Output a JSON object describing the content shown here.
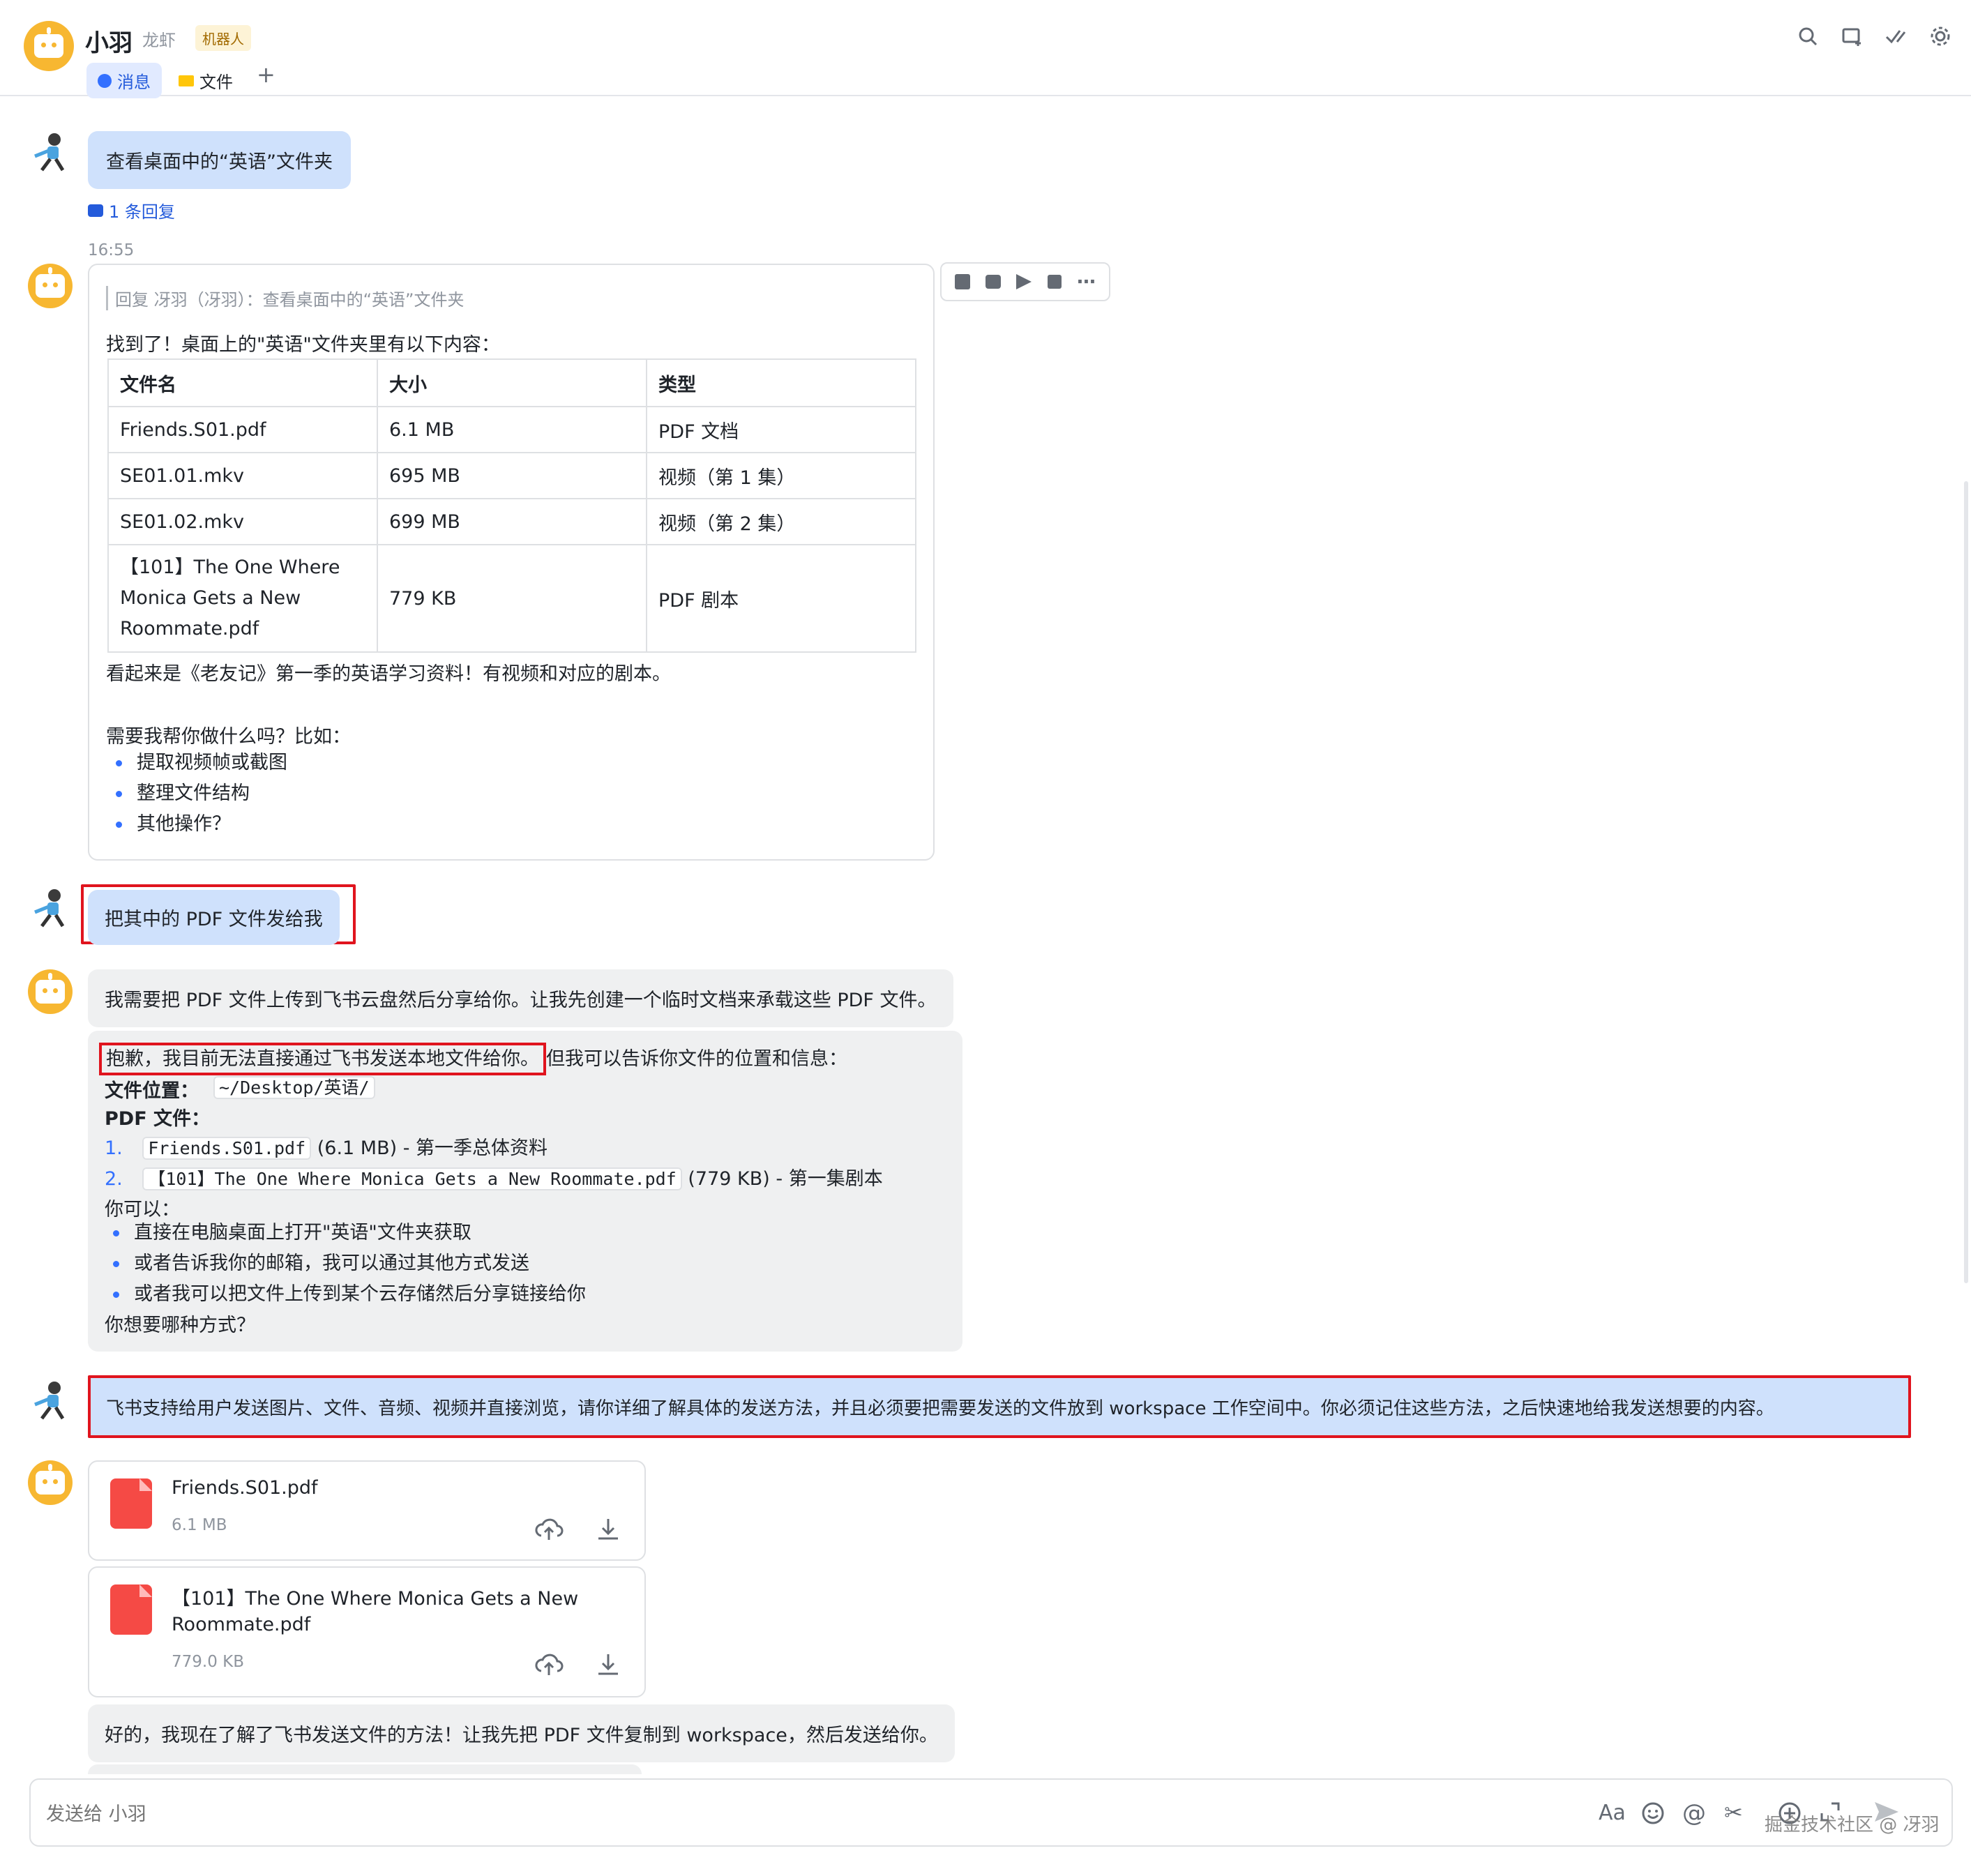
{
  "header": {
    "title": "小羽",
    "subtitle": "龙虾",
    "tag": "机器人",
    "tabs": [
      {
        "label": "消息",
        "icon": "chat-bubble-icon"
      },
      {
        "label": "文件",
        "icon": "folder-icon"
      }
    ],
    "add_tab": "+"
  },
  "messages": {
    "m1": {
      "text": "查看桌面中的“英语”文件夹",
      "replies": "1 条回复"
    },
    "m2": {
      "time": "16:55",
      "quote": "回复 冴羽（冴羽）：查看桌面中的“英语”文件夹",
      "intro": "找到了！桌面上的\"英语\"文件夹里有以下内容：",
      "table": {
        "headers": [
          "文件名",
          "大小",
          "类型"
        ],
        "rows": [
          [
            "Friends.S01.pdf",
            "6.1 MB",
            "PDF 文档"
          ],
          [
            "SE01.01.mkv",
            "695 MB",
            "视频（第 1 集）"
          ],
          [
            "SE01.02.mkv",
            "699 MB",
            "视频（第 2 集）"
          ],
          [
            "【101】The One Where Monica Gets a New Roommate.pdf",
            "779 KB",
            "PDF 剧本"
          ]
        ]
      },
      "summary": "看起来是《老友记》第一季的英语学习资料！有视频和对应的剧本。",
      "question": "需要我帮你做什么吗？比如：",
      "options": [
        "提取视频帧或截图",
        "整理文件结构",
        "其他操作？"
      ]
    },
    "m3": {
      "text": "把其中的 PDF 文件发给我"
    },
    "m4": {
      "text": "我需要把 PDF 文件上传到飞书云盘然后分享给你。让我先创建一个临时文档来承载这些 PDF 文件。"
    },
    "m5": {
      "highlight": "抱歉，我目前无法直接通过飞书发送本地文件给你。",
      "rest": "但我可以告诉你文件的位置和信息：",
      "loc_label": "文件位置：",
      "loc_value": "~/Desktop/英语/",
      "pdf_label": "PDF 文件：",
      "files": [
        {
          "num": "1.",
          "name": "Friends.S01.pdf",
          "desc": "(6.1 MB) - 第一季总体资料"
        },
        {
          "num": "2.",
          "name": "【101】The One Where Monica Gets a New Roommate.pdf",
          "desc": "(779 KB) - 第一集剧本"
        }
      ],
      "can_label": "你可以：",
      "ways": [
        "直接在电脑桌面上打开\"英语\"文件夹获取",
        "或者告诉我你的邮箱，我可以通过其他方式发送",
        "或者我可以把文件上传到某个云存储然后分享链接给你"
      ],
      "ask": "你想要哪种方式？"
    },
    "m6": {
      "text": "飞书支持给用户发送图片、文件、音频、视频并直接浏览，请你详细了解具体的发送方法，并且必须要把需要发送的文件放到 workspace 工作空间中。你必须记住这些方法，之后快速地给我发送想要的内容。"
    },
    "file1": {
      "name": "Friends.S01.pdf",
      "size": "6.1 MB"
    },
    "file2": {
      "name_line1": "【101】The One Where Monica Gets a New",
      "name_line2": "Roommate.pdf",
      "size": "779.0 KB"
    },
    "m7": {
      "text": "好的，我现在了解了飞书发送文件的方法！让我先把 PDF 文件复制到 workspace，然后发送给你。"
    }
  },
  "input": {
    "placeholder": "发送给 小羽",
    "font_btn": "Aa"
  },
  "watermark": "掘金技术社区 @ 冴羽"
}
